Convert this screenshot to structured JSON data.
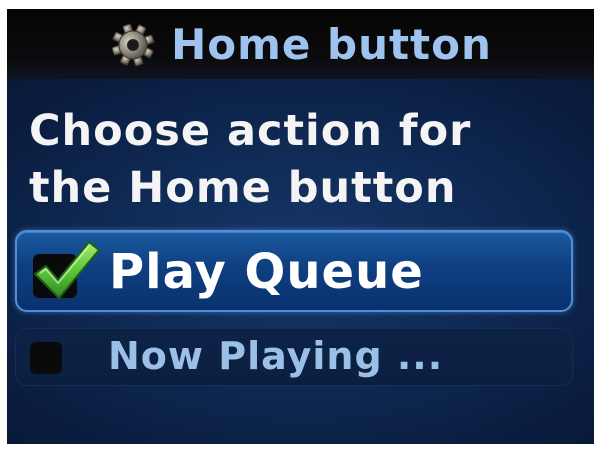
{
  "header": {
    "title": "Home button",
    "icon": "gear-icon"
  },
  "prompt": {
    "line1": "Choose action for",
    "line2": "the Home button"
  },
  "options": [
    {
      "label": "Play Queue",
      "checked": true,
      "icon": "checkmark-icon"
    },
    {
      "label": "Now Playing ...",
      "checked": false
    }
  ],
  "colors": {
    "title_text": "#9ec3ee",
    "selected_border": "#4f8fd6",
    "checkmark": "#58c23a",
    "background": "#0f2a55"
  }
}
